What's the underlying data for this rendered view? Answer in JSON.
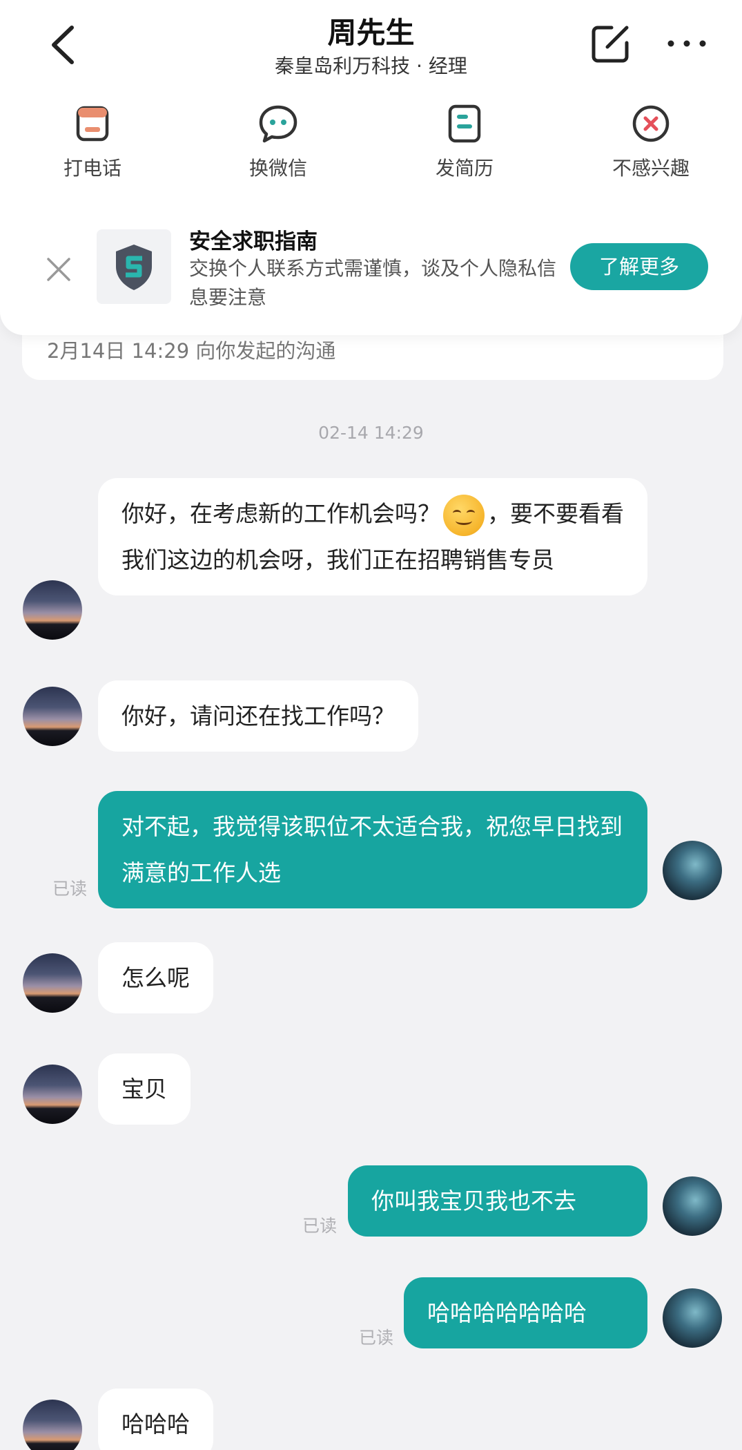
{
  "header": {
    "title": "周先生",
    "subtitle": "秦皇岛利万科技 · 经理"
  },
  "actions": [
    {
      "label": "打电话",
      "icon": "phone-card-icon"
    },
    {
      "label": "换微信",
      "icon": "chat-bubble-icon"
    },
    {
      "label": "发简历",
      "icon": "resume-icon"
    },
    {
      "label": "不感兴趣",
      "icon": "not-interested-icon"
    }
  ],
  "tip": {
    "title": "安全求职指南",
    "text": "交换个人联系方式需谨慎，谈及个人隐私信息要注意",
    "button": "了解更多"
  },
  "old_card_text": "2月14日 14:29 向你发起的沟通",
  "timestamp": "02-14 14:29",
  "messages": [
    {
      "side": "in",
      "text_before": "你好，在考虑新的工作机会吗？",
      "emoji": "smile-emoji",
      "text_after": "，要不要看看我们这边的机会呀，我们正在招聘销售专员"
    },
    {
      "side": "in",
      "text": "你好，请问还在找工作吗？"
    },
    {
      "side": "out",
      "text": "对不起，我觉得该职位不太适合我，祝您早日找到满意的工作人选",
      "status": "已读"
    },
    {
      "side": "in",
      "text": "怎么呢"
    },
    {
      "side": "in",
      "text": "宝贝"
    },
    {
      "side": "out",
      "text": "你叫我宝贝我也不去",
      "status": "已读"
    },
    {
      "side": "out",
      "text": "哈哈哈哈哈哈哈",
      "status": "已读"
    },
    {
      "side": "in",
      "text": "哈哈哈"
    }
  ],
  "colors": {
    "accent": "#17a5a0",
    "background": "#f2f2f4",
    "action_icon_red": "#e5505a",
    "action_icon_green": "#2aa39b"
  }
}
